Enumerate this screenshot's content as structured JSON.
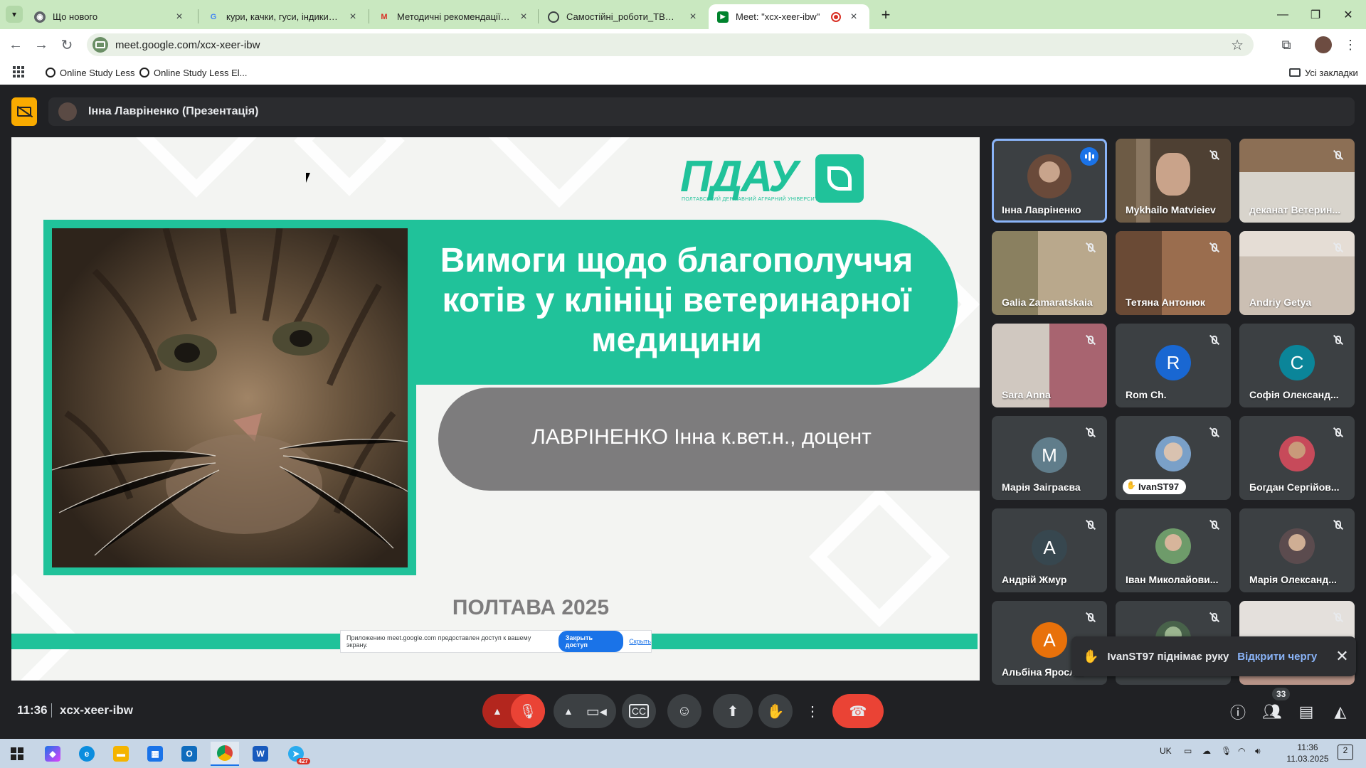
{
  "browser": {
    "tabs": [
      {
        "title": "Що нового",
        "favicon": "chrome-icon",
        "active": false
      },
      {
        "title": "кури, качки, гуси, індики на бі…",
        "favicon": "google-icon",
        "active": false
      },
      {
        "title": "Методичні рекомендації до ви…",
        "favicon": "gmail-icon",
        "active": false
      },
      {
        "title": "Самостійні_роботи_ТВП_птахі…",
        "favicon": "globe-icon",
        "active": false
      },
      {
        "title": "Meet: \"xcx-xeer-ibw\"",
        "favicon": "meet-icon",
        "active": true,
        "recording": true
      }
    ],
    "url": "meet.google.com/xcx-xeer-ibw",
    "bookmarks": [
      {
        "label": "Online Study Less"
      },
      {
        "label": "Online Study Less El..."
      }
    ],
    "all_bookmarks_label": "Усі закладки"
  },
  "meet": {
    "presenter_label": "Інна Лавріненко (Презентація)",
    "slide": {
      "logo_text": "ПДАУ",
      "logo_subtitle": "ПОЛТАВСЬКИЙ ДЕРЖАВНИЙ АГРАРНИЙ УНІВЕРСИТЕТ",
      "title": "Вимоги щодо благополуччя котів у клініці ветеринарної медицини",
      "author": "ЛАВРІНЕНКО Інна к.вет.н., доцент",
      "city_year": "ПОЛТАВА 2025",
      "share_notice": "Приложению meet.google.com предоставлен доступ к вашему экрану.",
      "share_stop_label": "Закрыть доступ",
      "share_hide_label": "Скрыть",
      "accent_color": "#20c29a",
      "grey_color": "#7d7c7d"
    },
    "participants": [
      {
        "name": "Інна Лавріненко",
        "state": "speaking",
        "kind": "photo"
      },
      {
        "name": "Mykhailo Matvieiev",
        "state": "muted",
        "kind": "video"
      },
      {
        "name": "деканат Ветерин...",
        "state": "muted",
        "kind": "video"
      },
      {
        "name": "Galia Zamaratskaia",
        "state": "muted",
        "kind": "video"
      },
      {
        "name": "Тетяна Антонюк",
        "state": "muted",
        "kind": "video"
      },
      {
        "name": "Andriy Getya",
        "state": "muted",
        "kind": "video"
      },
      {
        "name": "Sara Anna",
        "state": "muted",
        "kind": "video"
      },
      {
        "name": "Rom Ch.",
        "state": "muted",
        "kind": "letter",
        "letter": "R",
        "color": "#1967d2"
      },
      {
        "name": "Софія Олександ...",
        "state": "muted",
        "kind": "letter",
        "letter": "C",
        "color": "#0b8599"
      },
      {
        "name": "Марія Заіграєва",
        "state": "muted",
        "kind": "letter",
        "letter": "M",
        "color": "#607d8b"
      },
      {
        "name": "IvanST97",
        "state": "hand",
        "kind": "photo"
      },
      {
        "name": "Богдан Сергійов...",
        "state": "muted",
        "kind": "photo"
      },
      {
        "name": "Андрій Жмур",
        "state": "muted",
        "kind": "letter",
        "letter": "A",
        "color": "#37474f"
      },
      {
        "name": "Іван Миколайови...",
        "state": "muted",
        "kind": "photo"
      },
      {
        "name": "Марія Олександ...",
        "state": "muted",
        "kind": "photo"
      },
      {
        "name": "Альбіна Яросл...",
        "state": "muted",
        "kind": "letter",
        "letter": "A",
        "color": "#e8710a"
      },
      {
        "name": "",
        "state": "muted",
        "kind": "photo"
      },
      {
        "name": "",
        "state": "muted",
        "kind": "video"
      }
    ],
    "raise_hand_toast": {
      "message": "IvanST97 піднімає руку",
      "action": "Відкрити чергу"
    },
    "footer": {
      "time": "11:36",
      "meeting_code": "xcx-xeer-ibw",
      "participant_count": "33"
    }
  },
  "taskbar": {
    "language": "UK",
    "time": "11:36",
    "date": "11.03.2025",
    "notification_count": "2",
    "telegram_badge": "427"
  }
}
